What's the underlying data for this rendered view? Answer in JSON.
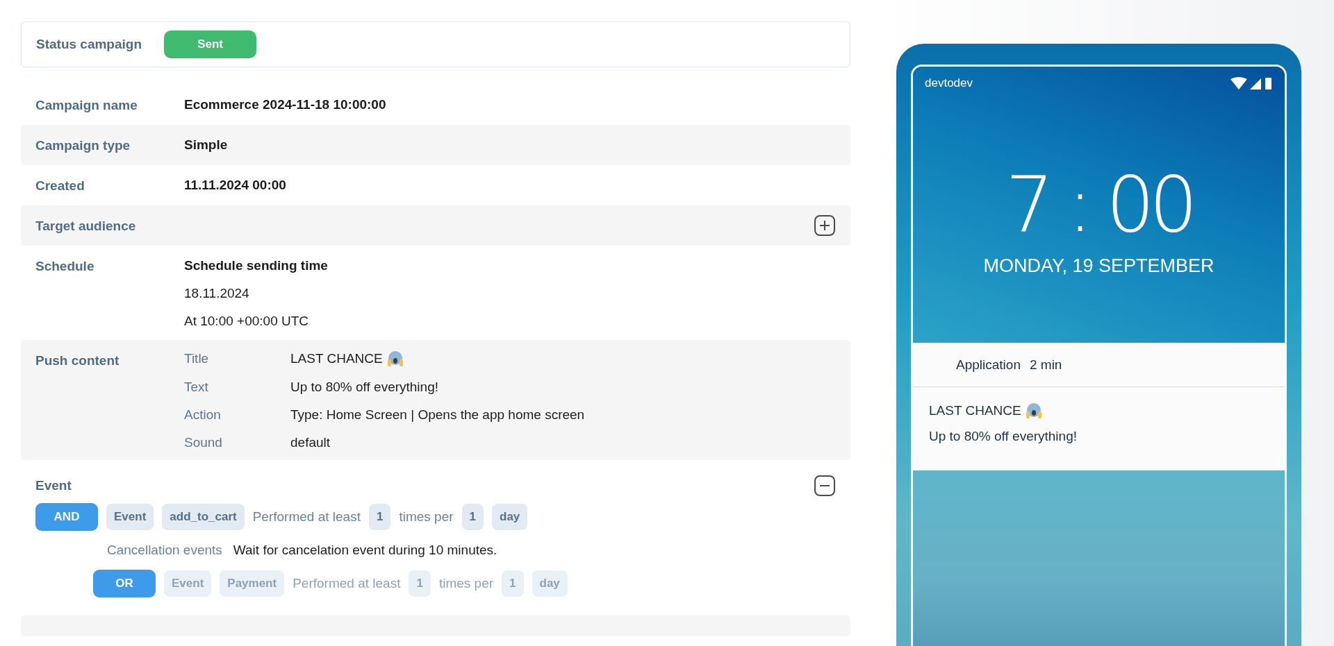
{
  "status": {
    "label": "Status  campaign",
    "badge": "Sent"
  },
  "rows": [
    {
      "kind": "field",
      "label": "Campaign name",
      "value": "Ecommerce 2024-11-18 10:00:00"
    },
    {
      "kind": "field",
      "label": "Campaign type",
      "value": "Simple"
    },
    {
      "kind": "field",
      "label": "Created",
      "value": "11.11.2024 00:00"
    },
    {
      "kind": "collapsible",
      "label": "Target  audience",
      "expanded": false
    },
    {
      "kind": "schedule",
      "label": "Schedule",
      "heading": "Schedule sending time",
      "lines": [
        "18.11.2024",
        "At 10:00 +00:00 UTC"
      ]
    },
    {
      "kind": "push",
      "label": "Push content",
      "items": [
        {
          "label": "Title",
          "value": "LAST CHANCE"
        },
        {
          "label": "Text",
          "value": "Up to 80% off everything!"
        },
        {
          "label": "Action",
          "value": "Type: Home Screen | Opens the app home screen"
        },
        {
          "label": "Sound",
          "value": "default"
        }
      ]
    },
    {
      "kind": "event",
      "label": "Event",
      "expanded": true,
      "conditions": [
        {
          "kind": "condition",
          "disabled": false,
          "operator": "AND",
          "tokens": [
            {
              "kind": "chip",
              "text": "Event"
            },
            {
              "kind": "chip",
              "text": "add_to_cart"
            },
            {
              "kind": "text",
              "text": "Performed at least"
            },
            {
              "kind": "chip",
              "text": "1"
            },
            {
              "kind": "text",
              "text": "times per"
            },
            {
              "kind": "chip",
              "text": "1"
            },
            {
              "kind": "chip",
              "text": "day"
            }
          ],
          "children": [
            {
              "kind": "note",
              "label": "Cancellation events",
              "text": "Wait for cancelation event during 10 minutes."
            },
            {
              "kind": "condition",
              "disabled": true,
              "operator": "OR",
              "tokens": [
                {
                  "kind": "chip",
                  "text": "Event"
                },
                {
                  "kind": "chip",
                  "text": "Payment"
                },
                {
                  "kind": "text",
                  "text": "Performed at least"
                },
                {
                  "kind": "chip",
                  "text": "1"
                },
                {
                  "kind": "text",
                  "text": "times per"
                },
                {
                  "kind": "chip",
                  "text": "1"
                },
                {
                  "kind": "chip",
                  "text": "day"
                }
              ]
            }
          ]
        }
      ]
    }
  ],
  "phone": {
    "carrier": "devtodev",
    "time": "7 : 00",
    "date": "MONDAY, 19 SEPTEMBER",
    "notification": {
      "app": "Application",
      "age": "2 min",
      "title": "LAST CHANCE",
      "text": "Up to 80% off everything!"
    }
  }
}
